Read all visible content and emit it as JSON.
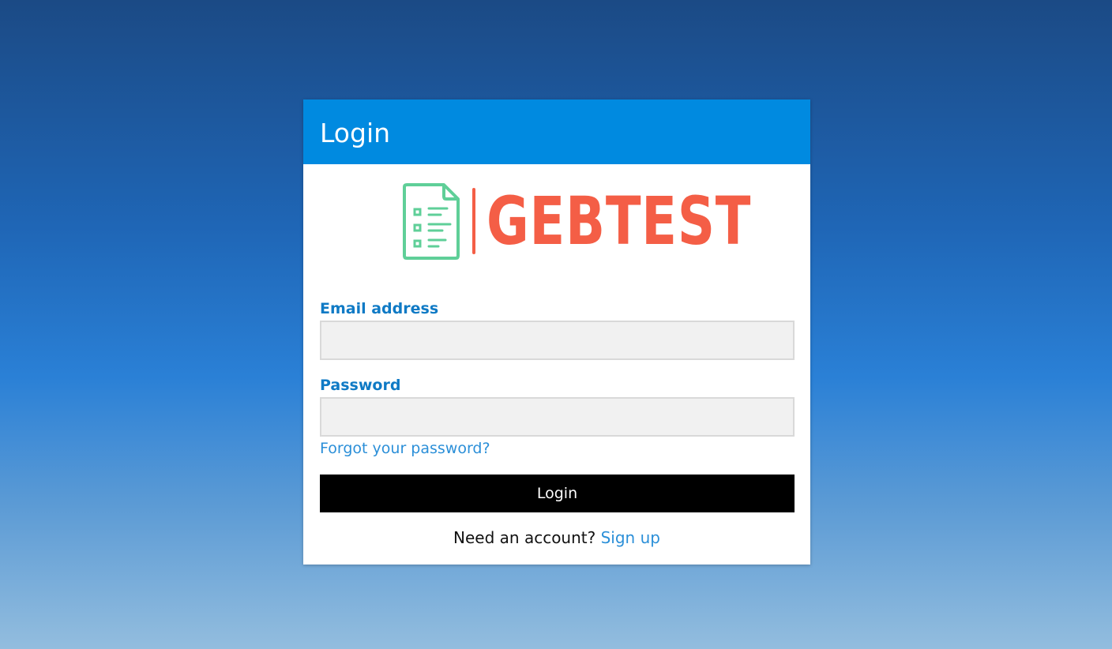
{
  "header": {
    "title": "Login"
  },
  "logo": {
    "icon": "document-checklist-icon",
    "text": "GEBTEST",
    "icon_color": "#5fcf98",
    "text_color": "#f45e46"
  },
  "form": {
    "email_label": "Email address",
    "email_value": "",
    "email_placeholder": "",
    "password_label": "Password",
    "password_value": "",
    "password_placeholder": "",
    "forgot_link": "Forgot your password?",
    "submit_label": "Login"
  },
  "footer": {
    "prompt": "Need an account?",
    "signup_link": "Sign up"
  },
  "colors": {
    "header_bg": "#008ae0",
    "label": "#0f7ac5",
    "link": "#2b8fd8",
    "button_bg": "#000000"
  }
}
